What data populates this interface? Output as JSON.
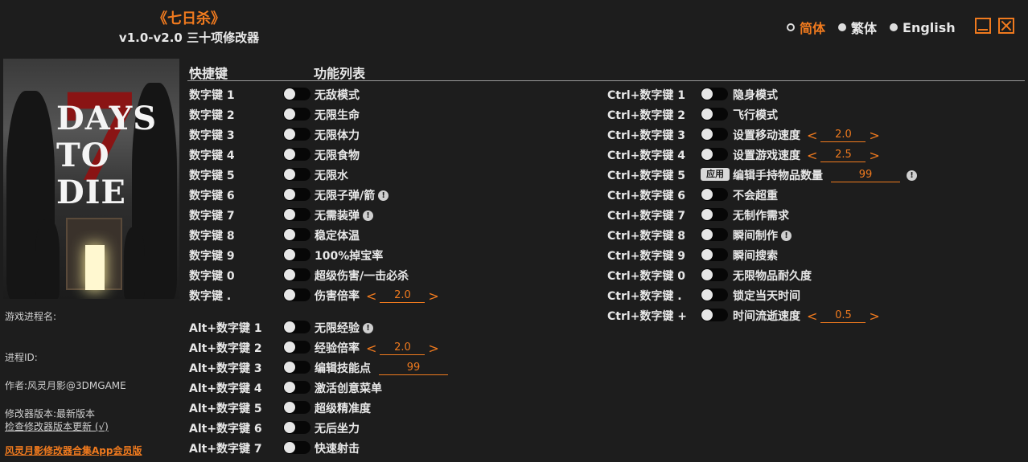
{
  "header": {
    "game_title": "《七日杀》",
    "subtitle": "v1.0-v2.0 三十项修改器"
  },
  "languages": [
    {
      "label": "简体",
      "active": true
    },
    {
      "label": "繁体",
      "active": false
    },
    {
      "label": "English",
      "active": false
    }
  ],
  "colors": {
    "accent": "#f07a1e",
    "background": "#1d1d1d",
    "text": "#e8e8e8"
  },
  "cover": {
    "logo_seven": "7",
    "logo_line1": "DAYS",
    "logo_line2": "TO DIE"
  },
  "side": {
    "process_name_label": "游戏进程名:",
    "process_id_label": "进程ID:",
    "author": "作者:风灵月影@3DMGAME",
    "version": "修改器版本:最新版本",
    "check_update": "检查修改器版本更新 (√)",
    "app_link": "风灵月影修改器合集App会员版"
  },
  "columns": {
    "hotkey": "快捷键",
    "features": "功能列表"
  },
  "left_rows": [
    {
      "key": "数字键 1",
      "label": "无敌模式"
    },
    {
      "key": "数字键 2",
      "label": "无限生命"
    },
    {
      "key": "数字键 3",
      "label": "无限体力"
    },
    {
      "key": "数字键 4",
      "label": "无限食物"
    },
    {
      "key": "数字键 5",
      "label": "无限水"
    },
    {
      "key": "数字键 6",
      "label": "无限子弹/箭"
    },
    {
      "key": "数字键 7",
      "label": "无需装弹"
    },
    {
      "key": "数字键 8",
      "label": "稳定体温"
    },
    {
      "key": "数字键 9",
      "label": "100%掉宝率"
    },
    {
      "key": "数字键 0",
      "label": "超级伤害/一击必杀"
    },
    {
      "key": "数字键 .",
      "label": "伤害倍率",
      "value": "2.0"
    },
    {
      "key": "Alt+数字键 1",
      "label": "无限经验"
    },
    {
      "key": "Alt+数字键 2",
      "label": "经验倍率",
      "value": "2.0"
    },
    {
      "key": "Alt+数字键 3",
      "label": "编辑技能点",
      "value": "99"
    },
    {
      "key": "Alt+数字键 4",
      "label": "激活创意菜单"
    },
    {
      "key": "Alt+数字键 5",
      "label": "超级精准度"
    },
    {
      "key": "Alt+数字键 6",
      "label": "无后坐力"
    },
    {
      "key": "Alt+数字键 7",
      "label": "快速射击"
    }
  ],
  "right_rows": [
    {
      "key": "Ctrl+数字键 1",
      "label": "隐身模式"
    },
    {
      "key": "Ctrl+数字键 2",
      "label": "飞行模式"
    },
    {
      "key": "Ctrl+数字键 3",
      "label": "设置移动速度",
      "value": "2.0"
    },
    {
      "key": "Ctrl+数字键 4",
      "label": "设置游戏速度",
      "value": "2.5"
    },
    {
      "key": "Ctrl+数字键 5",
      "label": "编辑手持物品数量",
      "value": "99",
      "apply": "应用"
    },
    {
      "key": "Ctrl+数字键 6",
      "label": "不会超重"
    },
    {
      "key": "Ctrl+数字键 7",
      "label": "无制作需求"
    },
    {
      "key": "Ctrl+数字键 8",
      "label": "瞬间制作"
    },
    {
      "key": "Ctrl+数字键 9",
      "label": "瞬间搜索"
    },
    {
      "key": "Ctrl+数字键 0",
      "label": "无限物品耐久度"
    },
    {
      "key": "Ctrl+数字键 .",
      "label": "锁定当天时间"
    },
    {
      "key": "Ctrl+数字键 +",
      "label": "时间流逝速度",
      "value": "0.5"
    }
  ],
  "symbols": {
    "arrow_left": "<",
    "arrow_right": ">",
    "warn": "!"
  }
}
